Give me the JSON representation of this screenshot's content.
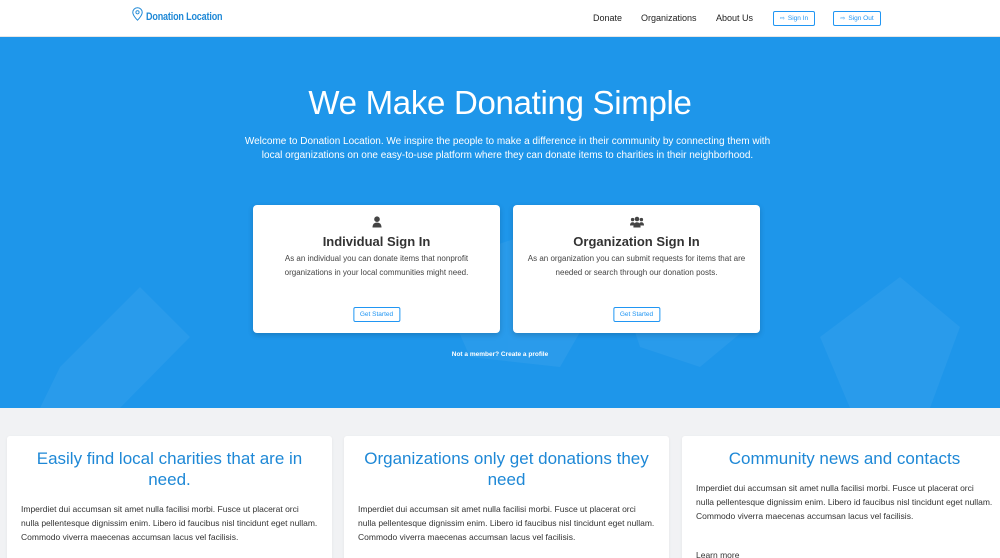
{
  "header": {
    "brand": "Donation Location",
    "nav": [
      "Donate",
      "Organizations",
      "About Us"
    ],
    "sign_in": "Sign In",
    "sign_out": "Sign Out"
  },
  "hero": {
    "title": "We Make Donating Simple",
    "intro": "Welcome to Donation Location. We inspire the people to make a difference in their community by connecting them with local organizations on one easy-to-use platform where they can donate items to charities in their neighborhood.",
    "individual": {
      "title": "Individual Sign In",
      "text": "As an individual you can donate items that nonprofit organizations in your local communities might need.",
      "button": "Get Started",
      "icon": "user-icon"
    },
    "organization": {
      "title": "Organization Sign In",
      "text": "As an organization you can submit requests for items that are needed or search through our donation posts.",
      "button": "Get Started",
      "icon": "users-icon"
    },
    "not_member": "Not a member? Create a profile"
  },
  "features": [
    {
      "title": "Easily find local charities that are in need.",
      "text": "Imperdiet dui accumsan sit amet nulla facilisi morbi. Fusce ut placerat orci nulla pellentesque dignissim enim. Libero id faucibus nisl tincidunt eget nullam. Commodo viverra maecenas accumsan lacus vel facilisis."
    },
    {
      "title": "Organizations only get donations they need",
      "text": "Imperdiet dui accumsan sit amet nulla facilisi morbi. Fusce ut placerat orci nulla pellentesque dignissim enim. Libero id faucibus nisl tincidunt eget nullam. Commodo viverra maecenas accumsan lacus vel facilisis."
    },
    {
      "title": "Community news and contacts",
      "text": "Imperdiet dui accumsan sit amet nulla facilisi morbi. Fusce ut placerat orci nulla pellentesque dignissim enim. Libero id faucibus nisl tincidunt eget nullam. Commodo viverra maecenas accumsan lacus vel facilisis.",
      "more": "Learn more"
    }
  ],
  "colors": {
    "accent": "#1e96ea",
    "link": "#2196f3",
    "heading": "#1e88d6"
  }
}
